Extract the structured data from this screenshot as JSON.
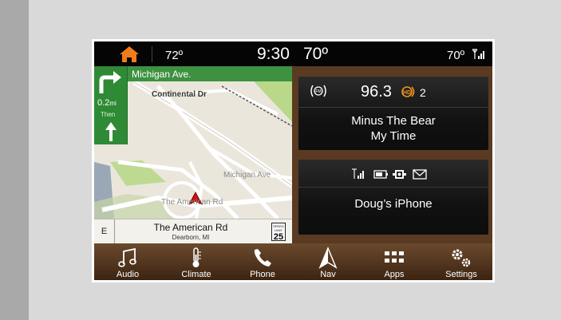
{
  "status_bar": {
    "outside_temp": "72º",
    "time": "9:30",
    "cabin_temp": "70º",
    "right_temp": "70º"
  },
  "map": {
    "next_street": "Michigan Ave.",
    "turn_distance": "0.2",
    "turn_distance_unit": "mi",
    "then_label": "Then",
    "labels": {
      "continental": "Continental Dr",
      "michigan": "Michigan Ave",
      "american": "The American Rd"
    },
    "bottom": {
      "compass": "E",
      "road_name": "The American Rd",
      "city": "Dearborn, MI",
      "speed_limit_label": "SPEED LIMIT",
      "speed_limit": "25"
    }
  },
  "radio": {
    "frequency": "96.3",
    "hd_channel": "2",
    "artist": "Minus The Bear",
    "song": "My Time"
  },
  "phone": {
    "device_name": "Doug’s iPhone"
  },
  "dock": {
    "items": [
      {
        "label": "Audio",
        "icon": "music-note-icon"
      },
      {
        "label": "Climate",
        "icon": "thermometer-icon"
      },
      {
        "label": "Phone",
        "icon": "phone-handset-icon"
      },
      {
        "label": "Nav",
        "icon": "navigation-arrow-icon"
      },
      {
        "label": "Apps",
        "icon": "apps-grid-icon"
      },
      {
        "label": "Settings",
        "icon": "gears-icon"
      }
    ]
  },
  "colors": {
    "home_icon": "#f07c1c",
    "nav_green": "#3d9140",
    "hd_orange": "#f0961c",
    "dock_wood": "#4a2f1a"
  }
}
